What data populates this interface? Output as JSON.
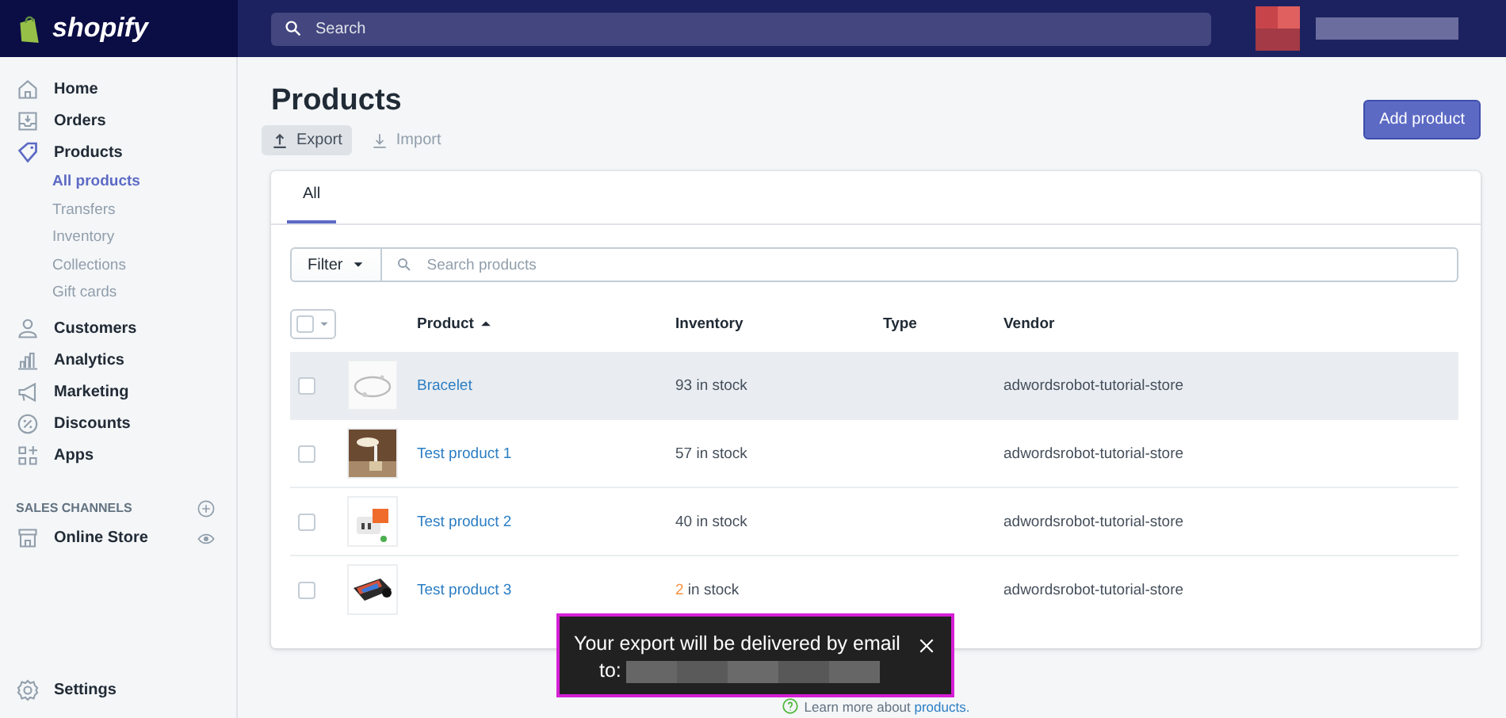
{
  "topbar": {
    "logo": "shopify",
    "search_placeholder": "Search"
  },
  "sidebar": {
    "items": [
      {
        "label": "Home",
        "selected": false
      },
      {
        "label": "Orders",
        "selected": false
      },
      {
        "label": "Products",
        "selected": true,
        "children": [
          {
            "label": "All products",
            "selected": true
          },
          {
            "label": "Transfers",
            "selected": false
          },
          {
            "label": "Inventory",
            "selected": false
          },
          {
            "label": "Collections",
            "selected": false
          },
          {
            "label": "Gift cards",
            "selected": false
          }
        ]
      },
      {
        "label": "Customers",
        "selected": false
      },
      {
        "label": "Analytics",
        "selected": false
      },
      {
        "label": "Marketing",
        "selected": false
      },
      {
        "label": "Discounts",
        "selected": false
      },
      {
        "label": "Apps",
        "selected": false
      }
    ],
    "sales_channels": {
      "heading": "SALES CHANNELS",
      "items": [
        {
          "label": "Online Store"
        }
      ]
    },
    "settings": {
      "label": "Settings"
    }
  },
  "page": {
    "title": "Products",
    "actions": [
      {
        "label": "Export",
        "selected": true
      },
      {
        "label": "Import",
        "selected": false
      }
    ],
    "primary_button": "Add product",
    "tabs": [
      {
        "label": "All",
        "selected": true
      }
    ],
    "filter": {
      "label": "Filter",
      "search_placeholder": "Search products"
    },
    "table": {
      "select_all_checked": false,
      "columns": [
        {
          "label": "Product",
          "sorted": true
        },
        {
          "label": "Inventory",
          "sorted": false
        },
        {
          "label": "Type",
          "sorted": false
        },
        {
          "label": "Vendor",
          "sorted": false
        }
      ],
      "rows": [
        {
          "product": "Bracelet",
          "inventory_count": "93",
          "inventory_unit": "in stock",
          "low_stock": false,
          "vendor": "adwordsrobot-tutorial-store",
          "highlighted": true,
          "checked": false
        },
        {
          "product": "Test product 1",
          "inventory_count": "57",
          "inventory_unit": "in stock",
          "low_stock": false,
          "vendor": "adwordsrobot-tutorial-store",
          "highlighted": false,
          "checked": false
        },
        {
          "product": "Test product 2",
          "inventory_count": "40",
          "inventory_unit": "in stock",
          "low_stock": false,
          "vendor": "adwordsrobot-tutorial-store",
          "highlighted": false,
          "checked": false
        },
        {
          "product": "Test product 3",
          "inventory_count": "2",
          "inventory_unit": "in stock",
          "low_stock": true,
          "vendor": "adwordsrobot-tutorial-store",
          "highlighted": false,
          "checked": false
        }
      ]
    },
    "footer": {
      "text": "Learn more about",
      "link": "products."
    }
  },
  "toast": {
    "message": "Your export will be delivered by email",
    "recipient_label": "to:"
  }
}
